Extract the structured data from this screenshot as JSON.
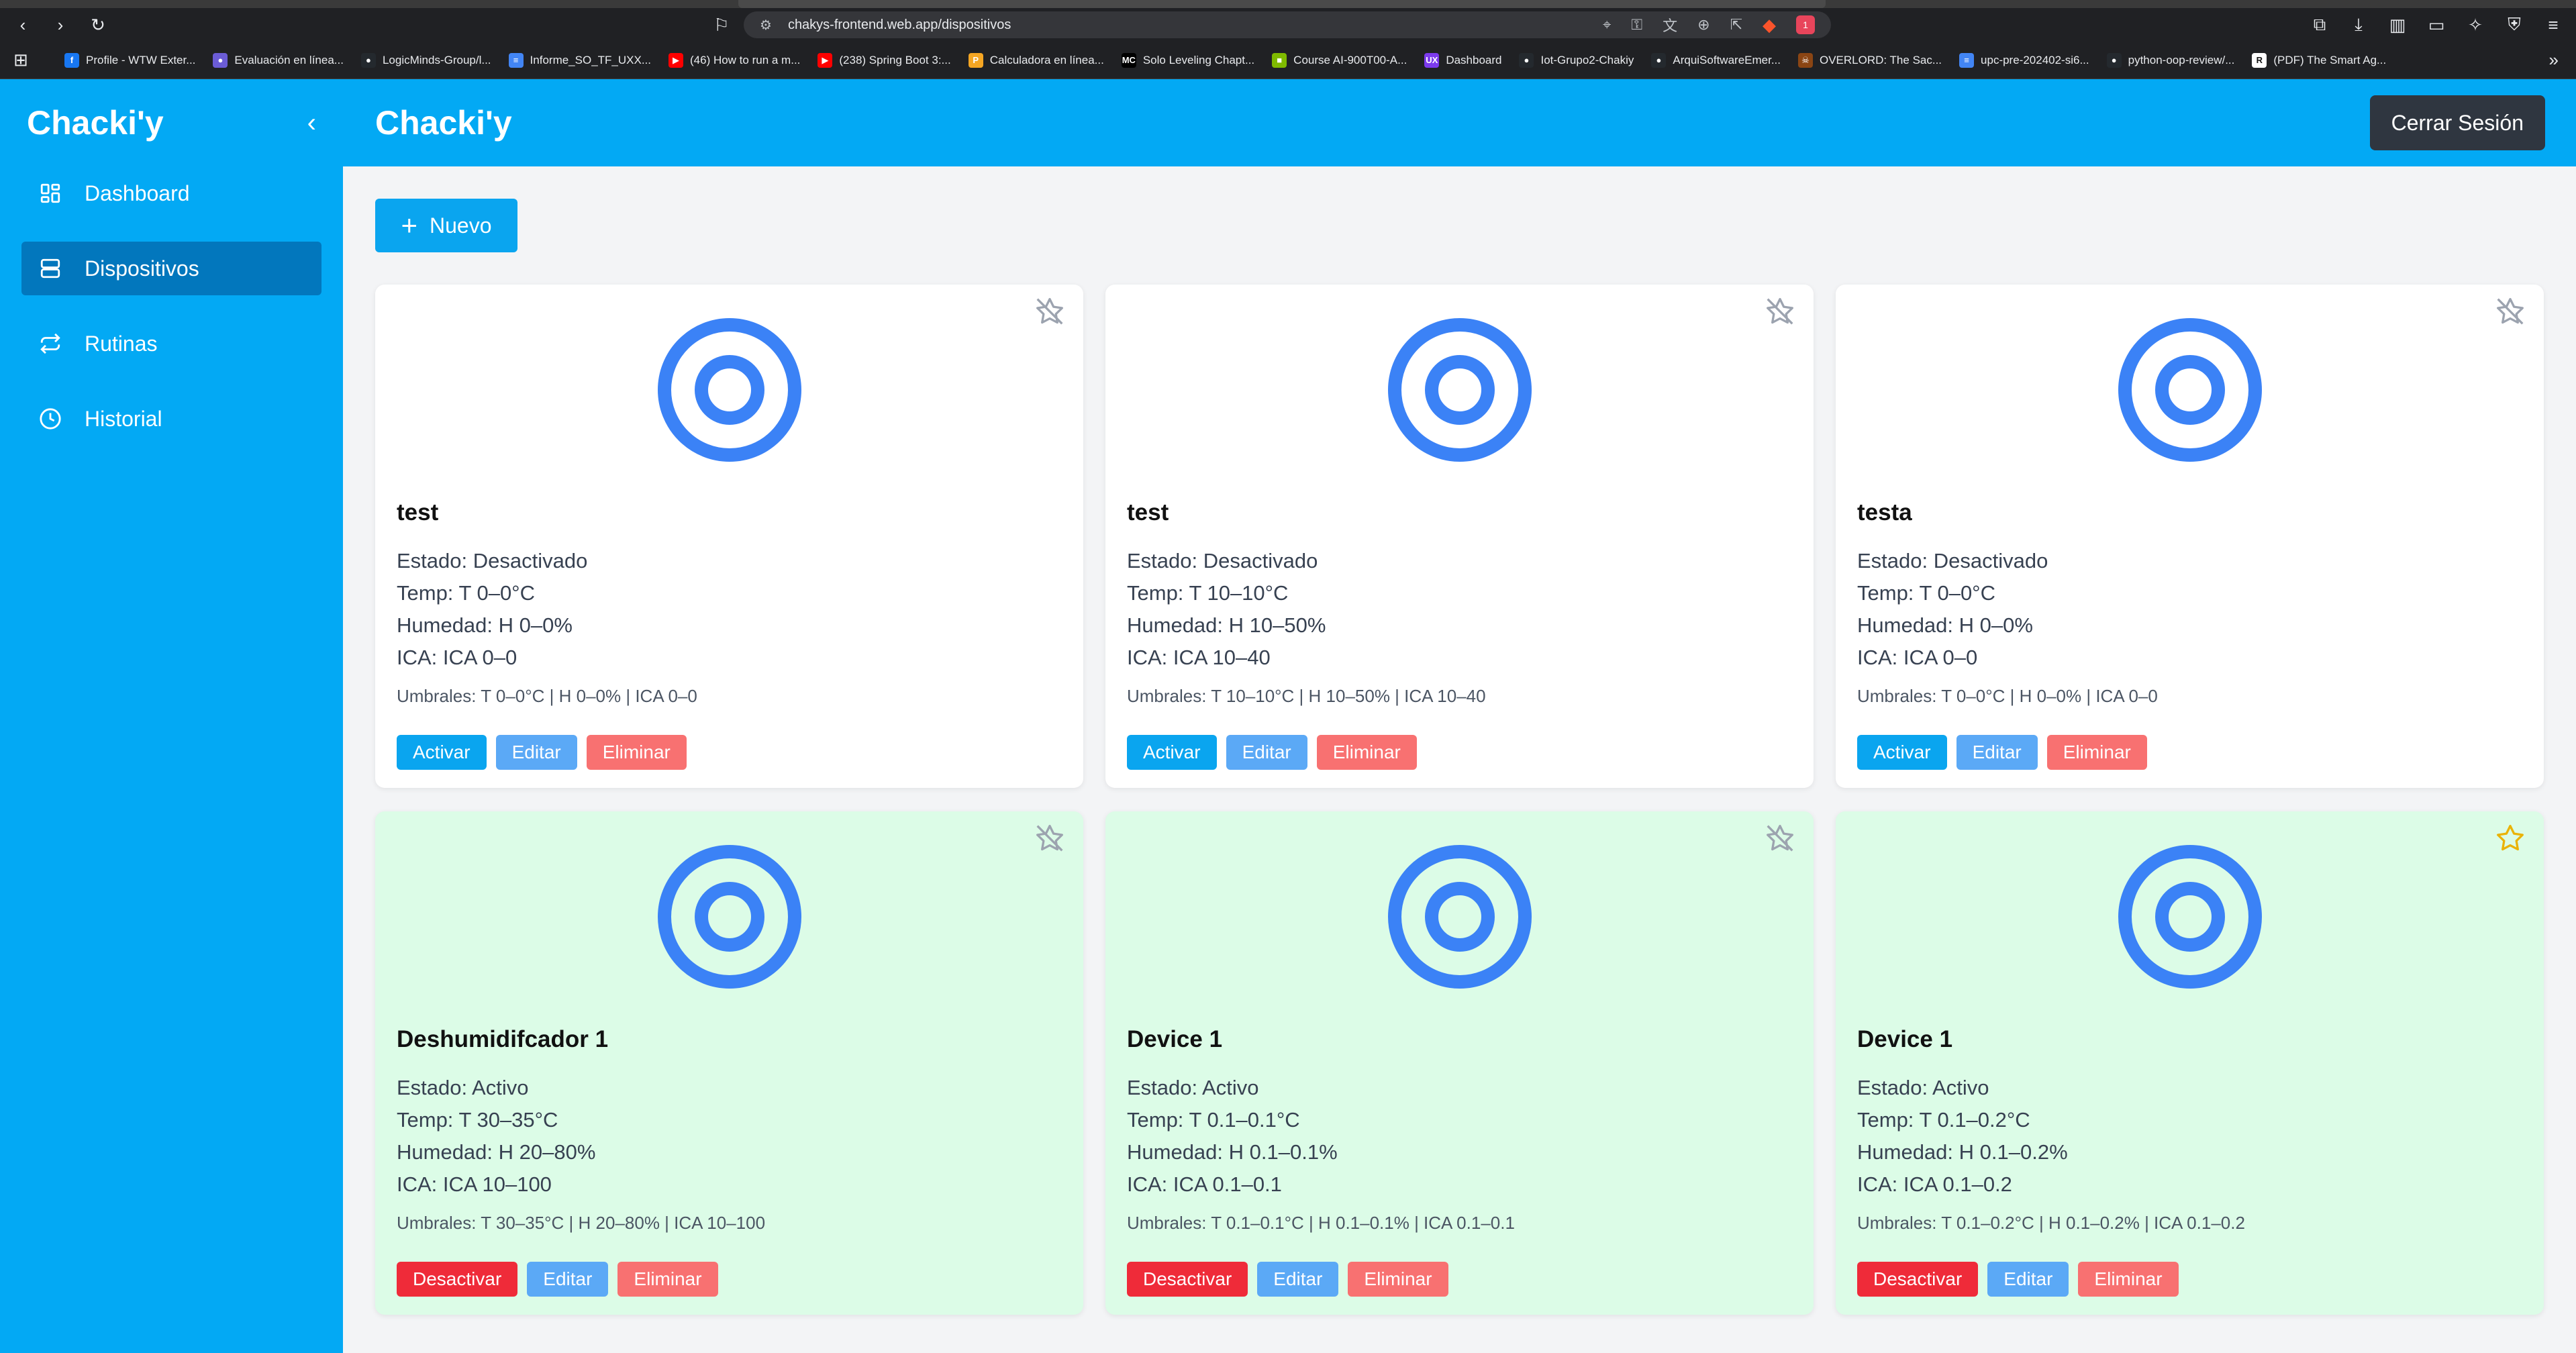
{
  "browser": {
    "url": "chakys-frontend.web.app/dispositivos",
    "bookmarks": [
      {
        "label": "Profile - WTW Exter...",
        "icon": "facebook-icon",
        "color": "#1877f2",
        "glyph": "f"
      },
      {
        "label": "Evaluación en línea...",
        "icon": "circle-icon",
        "color": "#6b5cd6",
        "glyph": "●"
      },
      {
        "label": "LogicMinds-Group/l...",
        "icon": "github-icon",
        "color": "#24292e",
        "glyph": "●"
      },
      {
        "label": "Informe_SO_TF_UXX...",
        "icon": "doc-icon",
        "color": "#4285f4",
        "glyph": "≡"
      },
      {
        "label": "(46) How to run a m...",
        "icon": "youtube-icon",
        "color": "#ff0000",
        "glyph": "▶"
      },
      {
        "label": "(238) Spring Boot 3:...",
        "icon": "youtube-icon",
        "color": "#ff0000",
        "glyph": "▶"
      },
      {
        "label": "Calculadora en línea...",
        "icon": "calculator-icon",
        "color": "#f5a623",
        "glyph": "P"
      },
      {
        "label": "Solo Leveling Chapt...",
        "icon": "mc-icon",
        "color": "#000000",
        "glyph": "MC"
      },
      {
        "label": "Course AI-900T00-A...",
        "icon": "microsoft-icon",
        "color": "#7fba00",
        "glyph": "■"
      },
      {
        "label": "Dashboard",
        "icon": "ux-icon",
        "color": "#7c3aed",
        "glyph": "UX"
      },
      {
        "label": "Iot-Grupo2-Chakiy",
        "icon": "github-icon",
        "color": "#24292e",
        "glyph": "●"
      },
      {
        "label": "ArquiSoftwareEmer...",
        "icon": "github-icon",
        "color": "#24292e",
        "glyph": "●"
      },
      {
        "label": "OVERLORD: The Sac...",
        "icon": "overlord-icon",
        "color": "#8b4513",
        "glyph": "☠"
      },
      {
        "label": "upc-pre-202402-si6...",
        "icon": "doc-icon",
        "color": "#4285f4",
        "glyph": "≡"
      },
      {
        "label": "python-oop-review/...",
        "icon": "github-icon",
        "color": "#24292e",
        "glyph": "●"
      },
      {
        "label": "(PDF) The Smart Ag...",
        "icon": "pdf-icon",
        "color": "#ffffff",
        "glyph": "R"
      }
    ],
    "rewards_count": "1"
  },
  "sidebar": {
    "brand": "Chacki'y",
    "items": [
      {
        "label": "Dashboard",
        "icon": "dashboard-icon",
        "active": false
      },
      {
        "label": "Dispositivos",
        "icon": "server-icon",
        "active": true
      },
      {
        "label": "Rutinas",
        "icon": "repeat-icon",
        "active": false
      },
      {
        "label": "Historial",
        "icon": "clock-icon",
        "active": false
      }
    ]
  },
  "header": {
    "title": "Chacki'y",
    "logout_label": "Cerrar Sesión"
  },
  "main": {
    "new_label": "Nuevo"
  },
  "devices": [
    {
      "name": "test",
      "estado": "Estado: Desactivado",
      "temp": "Temp: T 0–0°C",
      "humedad": "Humedad: H 0–0%",
      "ica": "ICA: ICA 0–0",
      "umbrales": "Umbrales: T 0–0°C | H 0–0% | ICA 0–0",
      "toggle_label": "Activar",
      "active": false,
      "favorite": false
    },
    {
      "name": "test",
      "estado": "Estado: Desactivado",
      "temp": "Temp: T 10–10°C",
      "humedad": "Humedad: H 10–50%",
      "ica": "ICA: ICA 10–40",
      "umbrales": "Umbrales: T 10–10°C | H 10–50% | ICA 10–40",
      "toggle_label": "Activar",
      "active": false,
      "favorite": false
    },
    {
      "name": "testa",
      "estado": "Estado: Desactivado",
      "temp": "Temp: T 0–0°C",
      "humedad": "Humedad: H 0–0%",
      "ica": "ICA: ICA 0–0",
      "umbrales": "Umbrales: T 0–0°C | H 0–0% | ICA 0–0",
      "toggle_label": "Activar",
      "active": false,
      "favorite": false
    },
    {
      "name": "Deshumidifcador 1",
      "estado": "Estado: Activo",
      "temp": "Temp: T 30–35°C",
      "humedad": "Humedad: H 20–80%",
      "ica": "ICA: ICA 10–100",
      "umbrales": "Umbrales: T 30–35°C | H 20–80% | ICA 10–100",
      "toggle_label": "Desactivar",
      "active": true,
      "favorite": false
    },
    {
      "name": "Device 1",
      "estado": "Estado: Activo",
      "temp": "Temp: T 0.1–0.1°C",
      "humedad": "Humedad: H 0.1–0.1%",
      "ica": "ICA: ICA 0.1–0.1",
      "umbrales": "Umbrales: T 0.1–0.1°C | H 0.1–0.1% | ICA 0.1–0.1",
      "toggle_label": "Desactivar",
      "active": true,
      "favorite": false
    },
    {
      "name": "Device 1",
      "estado": "Estado: Activo",
      "temp": "Temp: T 0.1–0.2°C",
      "humedad": "Humedad: H 0.1–0.2%",
      "ica": "ICA: ICA 0.1–0.2",
      "umbrales": "Umbrales: T 0.1–0.2°C | H 0.1–0.2% | ICA 0.1–0.2",
      "toggle_label": "Desactivar",
      "active": true,
      "favorite": true
    }
  ],
  "card_actions": {
    "edit_label": "Editar",
    "delete_label": "Eliminar"
  },
  "colors": {
    "sidebar": "#03a9f4",
    "sidebar_active": "#0277bd",
    "active_card": "#dcfce7",
    "device_icon": "#3b82f6",
    "favorite_star": "#eab308"
  }
}
